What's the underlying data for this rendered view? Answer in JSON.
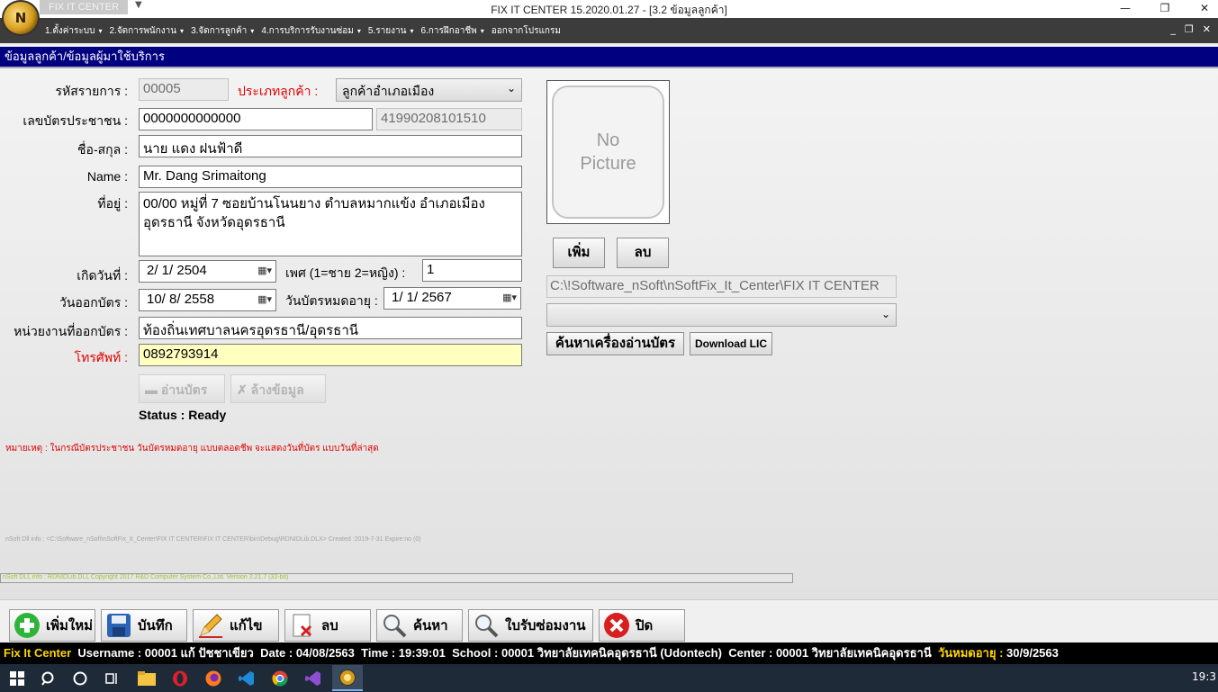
{
  "window": {
    "title": "FIX IT CENTER 15.2020.01.27 - [3.2 ข้อมูลลูกค้า]",
    "app_tag": "FIX IT CENTER",
    "logo_text": "N",
    "minimize": "—",
    "restore": "❐",
    "close": "✕",
    "drop_arrow": "▼"
  },
  "menu": {
    "items": [
      {
        "label": "1.ตั้งค่าระบบ"
      },
      {
        "label": "2.จัดการพนักงาน"
      },
      {
        "label": "3.จัดการลูกค้า"
      },
      {
        "label": "4.การบริการรับงานซ่อม"
      },
      {
        "label": "5.รายงาน"
      },
      {
        "label": "6.การฝึกอาชีพ"
      },
      {
        "label": "ออกจากโปรแกรม"
      }
    ],
    "caret": "▾",
    "child_min": "_",
    "child_restore": "❐",
    "child_close": "✕"
  },
  "section": {
    "title": "ข้อมูลลูกค้า/ข้อมูลผู้มาใช้บริการ"
  },
  "form": {
    "record_id_label": "รหัสรายการ :",
    "record_id": "00005",
    "customer_type_label": "ประเภทลูกค้า :",
    "customer_type": "ลูกค้าอำเภอเมือง",
    "id_card_label": "เลขบัตรประชาชน :",
    "id_card": "0000000000000",
    "id_card_extra": "41990208101510",
    "fullname_th_label": "ชื่อ-สกุล :",
    "fullname_th": "นาย แดง  ฝนฟ้าดี",
    "name_en_label": "Name :",
    "name_en": "Mr. Dang  Srimaitong",
    "address_label": "ที่อยู่ :",
    "address": "00/00 หมู่ที่ 7  ซอยบ้านโนนยาง  ตำบลหมากแข้ง อำเภอเมืองอุดรธานี จังหวัดอุดรธานี",
    "birthdate_label": "เกิดวันที่ :",
    "birthdate": "2/  1/  2504",
    "gender_label": "เพศ (1=ชาย  2=หญิง) :",
    "gender": "1",
    "issue_date_label": "วันออกบัตร :",
    "issue_date": "10/  8/  2558",
    "expiry_date_label": "วันบัตรหมดอายุ :",
    "expiry_date": "1/  1/  2567",
    "issuer_label": "หน่วยงานที่ออกบัตร :",
    "issuer": "ท้องถิ่นเทศบาลนครอุดรธานี/อุดรธานี",
    "phone_label": "โทรศัพท์ :",
    "phone": "0892793914",
    "read_card_label": "อ่านบัตร",
    "clear_label": "ล้างข้อมูล",
    "status_label": "Status : Ready",
    "note": "หมายเหตุ : ในกรณีบัตรประชาชน วันบัตรหมดอายุ แบบตลอดชีพ จะแสดงวันที่บัตร แบบวันที่ล่าสุด",
    "dll_info": "nSoft Dll info : <C:\\Software_nSoft\\nSoftFix_It_Center\\FIX IT CENTER\\FIX IT CENTER\\bin\\Debug\\RDNIDLib.DLX> Created :2019-7-31 Expire:no (0)",
    "progress_text": "nSoft DLL info : RDNIDLib.DLL Copyright 2017 R&D Computer System Co.,Ltd. Version 2.21.7 (32-bit)"
  },
  "picture": {
    "placeholder_line1": "No",
    "placeholder_line2": "Picture",
    "add_label": "เพิ่ม",
    "delete_label": "ลบ",
    "path": "C:\\!Software_nSoft\\nSoftFix_It_Center\\FIX IT CENTER",
    "find_reader_label": "ค้นหาเครื่องอ่านบัตร",
    "download_lic_label": "Download LIC"
  },
  "toolbar": {
    "new_label": "เพิ่มใหม่",
    "save_label": "บันทึก",
    "edit_label": "แก้ไข",
    "delete_label": "ลบ",
    "search_label": "ค้นหา",
    "repair_label": "ใบรับซ่อมงาน",
    "close_label": "ปิด"
  },
  "status_bar": {
    "app": "Fix It Center",
    "username": "Username : 00001  แก้  ปัชชาเขียว",
    "date": "Date : 04/08/2563",
    "time": "Time : 19:39:01",
    "school_label": "School :",
    "school": "00001  วิทยาลัยเทคนิคอุดรธานี (Udontech)",
    "center_label": "Center :",
    "center": "00001  วิทยาลัยเทคนิคอุดรธานี",
    "expire_label": "วันหมดอายุ :",
    "expire": "30/9/2563"
  },
  "taskbar": {
    "clock": "19:3"
  }
}
